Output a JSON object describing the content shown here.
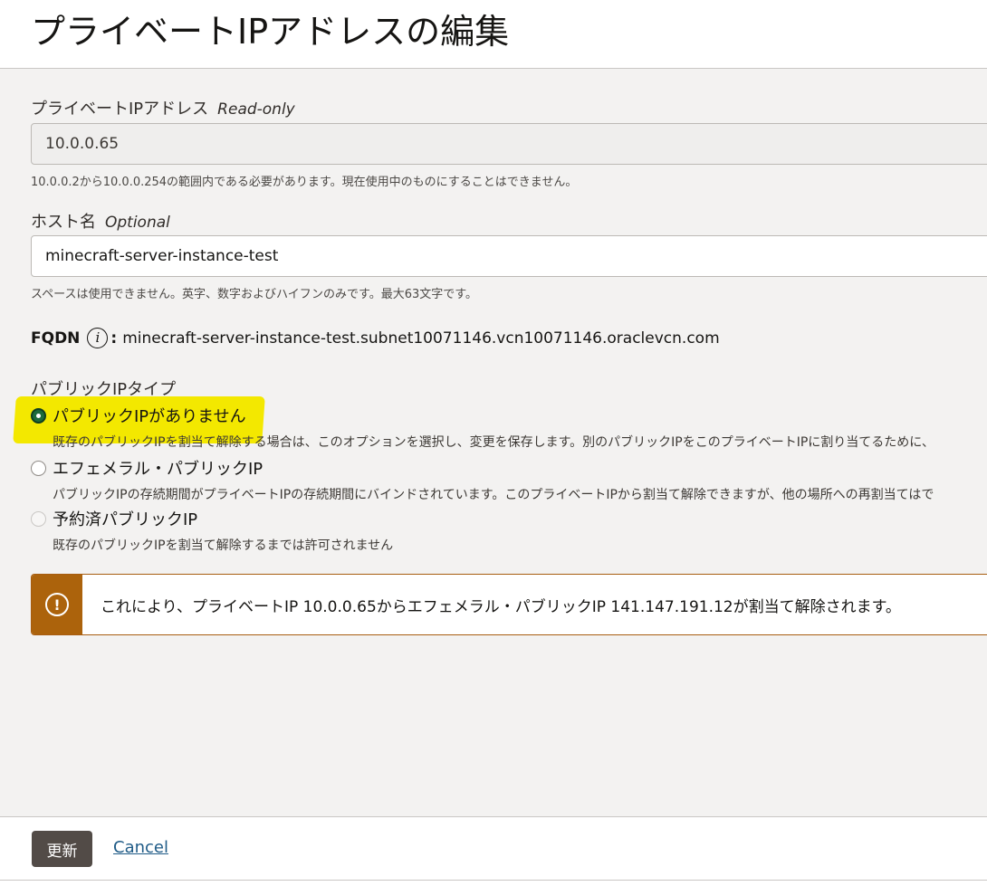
{
  "page": {
    "title": "プライベートIPアドレスの編集"
  },
  "private_ip": {
    "label": "プライベートIPアドレス",
    "hint": "Read-only",
    "value": "10.0.0.65",
    "help": "10.0.0.2から10.0.0.254の範囲内である必要があります。現在使用中のものにすることはできません。"
  },
  "hostname": {
    "label": "ホスト名",
    "hint": "Optional",
    "value": "minecraft-server-instance-test",
    "help": "スペースは使用できません。英字、数字およびハイフンのみです。最大63文字です。"
  },
  "fqdn": {
    "label": "FQDN",
    "info_glyph": "i",
    "colon": ":",
    "value": "minecraft-server-instance-test.subnet10071146.vcn10071146.oraclevcn.com"
  },
  "public_ip_type": {
    "label": "パブリックIPタイプ",
    "options": [
      {
        "label": "パブリックIPがありません",
        "description": "既存のパブリックIPを割当て解除する場合は、このオプションを選択し、変更を保存します。別のパブリックIPをこのプライベートIPに割り当てるために、",
        "checked": true
      },
      {
        "label": "エフェメラル・パブリックIP",
        "description": "パブリックIPの存続期間がプライベートIPの存続期間にバインドされています。このプライベートIPから割当て解除できますが、他の場所への再割当てはで",
        "checked": false
      },
      {
        "label": "予約済パブリックIP",
        "description": "既存のパブリックIPを割当て解除するまでは許可されません",
        "checked": false,
        "disabled": true
      }
    ]
  },
  "warning": {
    "icon": "!",
    "message": "これにより、プライベートIP 10.0.0.65からエフェメラル・パブリックIP 141.147.191.12が割当て解除されます。"
  },
  "footer": {
    "update_label": "更新",
    "cancel_label": "Cancel"
  },
  "colors": {
    "highlight": "#f3e800",
    "warning_accent": "#ac630c",
    "primary_button": "#524b47",
    "link": "#1f5b87",
    "radio_checked": "#1c6b3b"
  }
}
